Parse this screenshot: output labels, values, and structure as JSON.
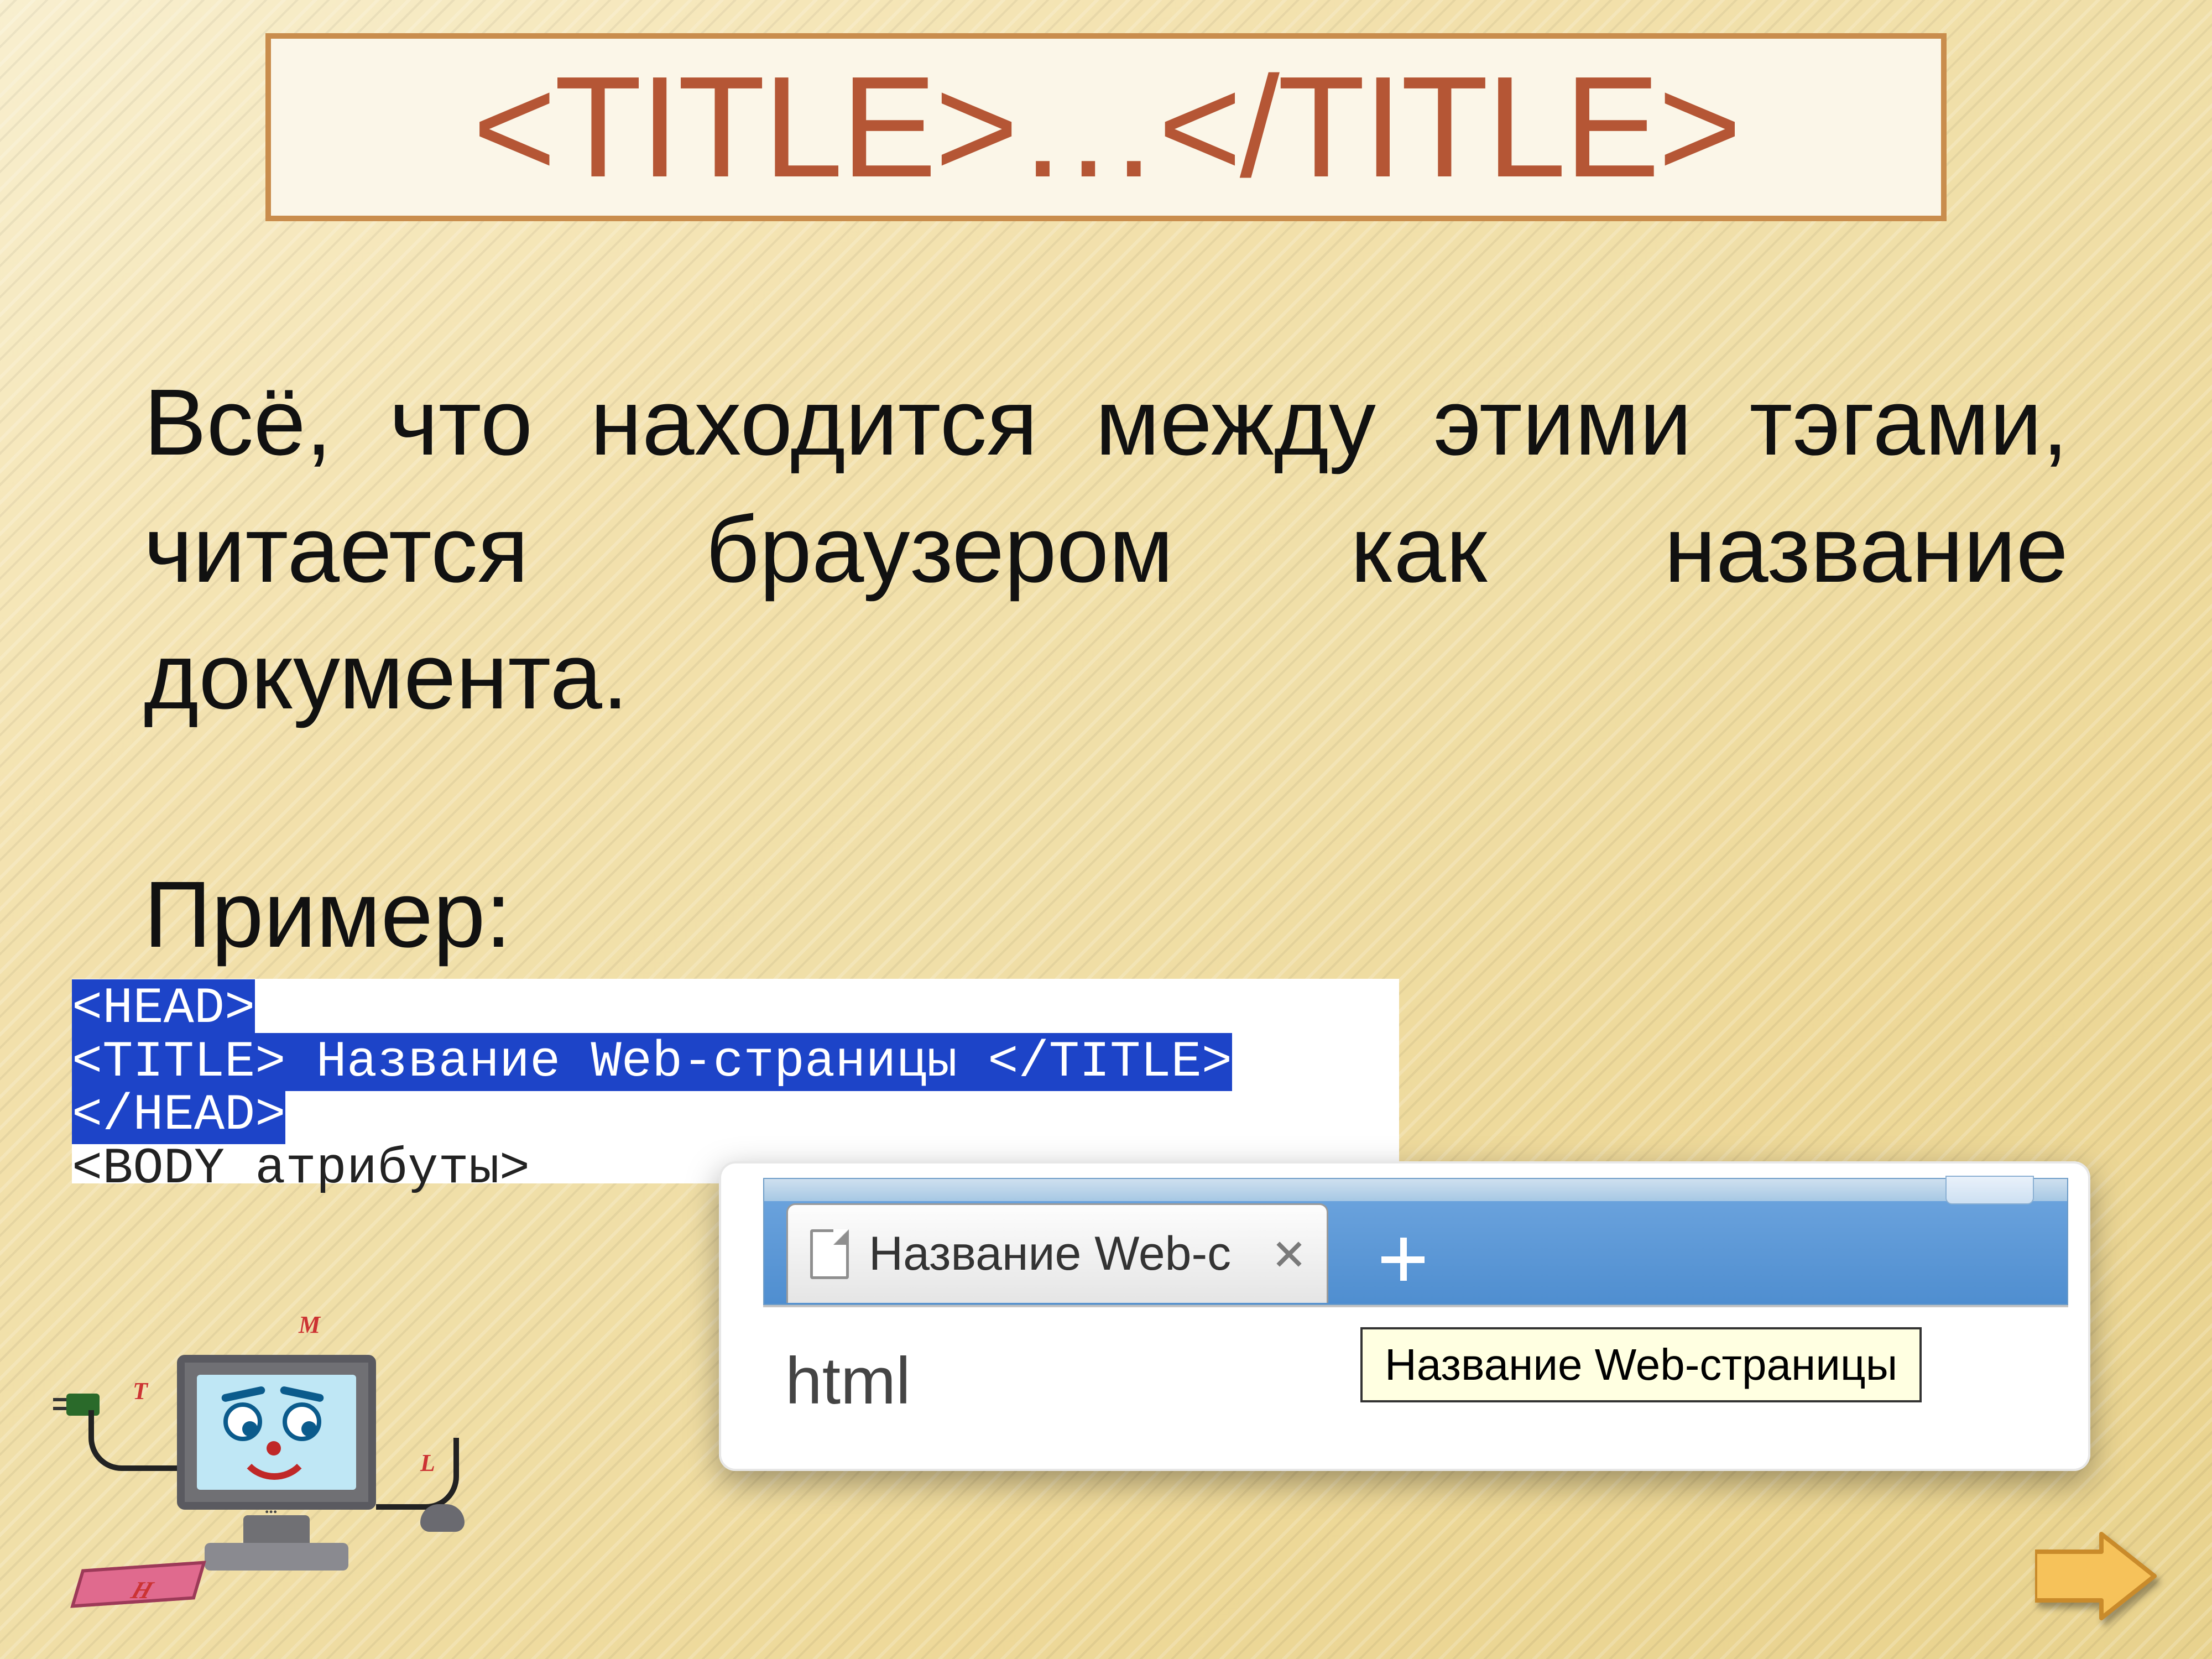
{
  "header": {
    "title": "<TITLE>…</TITLE>"
  },
  "body": {
    "paragraph": "Всё, что находится между этими тэгами, читается браузером как название документа.",
    "example_label": "Пример:"
  },
  "code": {
    "line1": "<HEAD>",
    "line2": "<TITLE> Название Web-страницы </TITLE>",
    "line3": "</HEAD>",
    "line4_partial": "<BODY атрибуты>"
  },
  "browser": {
    "tab_title": "Название Web-с",
    "url_text": "html",
    "tooltip": "Название Web-страницы"
  },
  "mascot_letters": {
    "T": "T",
    "M": "M",
    "L": "L",
    "H": "H",
    "dots": "..."
  }
}
